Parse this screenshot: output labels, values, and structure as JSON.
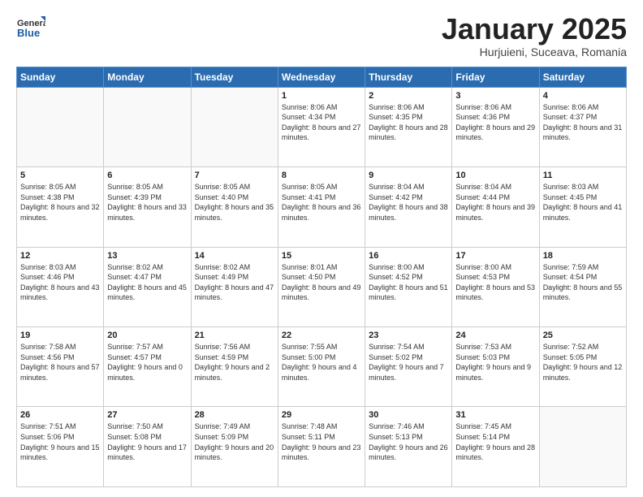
{
  "header": {
    "logo_line1": "General",
    "logo_line2": "Blue",
    "month": "January 2025",
    "location": "Hurjuieni, Suceava, Romania"
  },
  "weekdays": [
    "Sunday",
    "Monday",
    "Tuesday",
    "Wednesday",
    "Thursday",
    "Friday",
    "Saturday"
  ],
  "weeks": [
    [
      {
        "day": "",
        "info": ""
      },
      {
        "day": "",
        "info": ""
      },
      {
        "day": "",
        "info": ""
      },
      {
        "day": "1",
        "info": "Sunrise: 8:06 AM\nSunset: 4:34 PM\nDaylight: 8 hours and 27 minutes."
      },
      {
        "day": "2",
        "info": "Sunrise: 8:06 AM\nSunset: 4:35 PM\nDaylight: 8 hours and 28 minutes."
      },
      {
        "day": "3",
        "info": "Sunrise: 8:06 AM\nSunset: 4:36 PM\nDaylight: 8 hours and 29 minutes."
      },
      {
        "day": "4",
        "info": "Sunrise: 8:06 AM\nSunset: 4:37 PM\nDaylight: 8 hours and 31 minutes."
      }
    ],
    [
      {
        "day": "5",
        "info": "Sunrise: 8:05 AM\nSunset: 4:38 PM\nDaylight: 8 hours and 32 minutes."
      },
      {
        "day": "6",
        "info": "Sunrise: 8:05 AM\nSunset: 4:39 PM\nDaylight: 8 hours and 33 minutes."
      },
      {
        "day": "7",
        "info": "Sunrise: 8:05 AM\nSunset: 4:40 PM\nDaylight: 8 hours and 35 minutes."
      },
      {
        "day": "8",
        "info": "Sunrise: 8:05 AM\nSunset: 4:41 PM\nDaylight: 8 hours and 36 minutes."
      },
      {
        "day": "9",
        "info": "Sunrise: 8:04 AM\nSunset: 4:42 PM\nDaylight: 8 hours and 38 minutes."
      },
      {
        "day": "10",
        "info": "Sunrise: 8:04 AM\nSunset: 4:44 PM\nDaylight: 8 hours and 39 minutes."
      },
      {
        "day": "11",
        "info": "Sunrise: 8:03 AM\nSunset: 4:45 PM\nDaylight: 8 hours and 41 minutes."
      }
    ],
    [
      {
        "day": "12",
        "info": "Sunrise: 8:03 AM\nSunset: 4:46 PM\nDaylight: 8 hours and 43 minutes."
      },
      {
        "day": "13",
        "info": "Sunrise: 8:02 AM\nSunset: 4:47 PM\nDaylight: 8 hours and 45 minutes."
      },
      {
        "day": "14",
        "info": "Sunrise: 8:02 AM\nSunset: 4:49 PM\nDaylight: 8 hours and 47 minutes."
      },
      {
        "day": "15",
        "info": "Sunrise: 8:01 AM\nSunset: 4:50 PM\nDaylight: 8 hours and 49 minutes."
      },
      {
        "day": "16",
        "info": "Sunrise: 8:00 AM\nSunset: 4:52 PM\nDaylight: 8 hours and 51 minutes."
      },
      {
        "day": "17",
        "info": "Sunrise: 8:00 AM\nSunset: 4:53 PM\nDaylight: 8 hours and 53 minutes."
      },
      {
        "day": "18",
        "info": "Sunrise: 7:59 AM\nSunset: 4:54 PM\nDaylight: 8 hours and 55 minutes."
      }
    ],
    [
      {
        "day": "19",
        "info": "Sunrise: 7:58 AM\nSunset: 4:56 PM\nDaylight: 8 hours and 57 minutes."
      },
      {
        "day": "20",
        "info": "Sunrise: 7:57 AM\nSunset: 4:57 PM\nDaylight: 9 hours and 0 minutes."
      },
      {
        "day": "21",
        "info": "Sunrise: 7:56 AM\nSunset: 4:59 PM\nDaylight: 9 hours and 2 minutes."
      },
      {
        "day": "22",
        "info": "Sunrise: 7:55 AM\nSunset: 5:00 PM\nDaylight: 9 hours and 4 minutes."
      },
      {
        "day": "23",
        "info": "Sunrise: 7:54 AM\nSunset: 5:02 PM\nDaylight: 9 hours and 7 minutes."
      },
      {
        "day": "24",
        "info": "Sunrise: 7:53 AM\nSunset: 5:03 PM\nDaylight: 9 hours and 9 minutes."
      },
      {
        "day": "25",
        "info": "Sunrise: 7:52 AM\nSunset: 5:05 PM\nDaylight: 9 hours and 12 minutes."
      }
    ],
    [
      {
        "day": "26",
        "info": "Sunrise: 7:51 AM\nSunset: 5:06 PM\nDaylight: 9 hours and 15 minutes."
      },
      {
        "day": "27",
        "info": "Sunrise: 7:50 AM\nSunset: 5:08 PM\nDaylight: 9 hours and 17 minutes."
      },
      {
        "day": "28",
        "info": "Sunrise: 7:49 AM\nSunset: 5:09 PM\nDaylight: 9 hours and 20 minutes."
      },
      {
        "day": "29",
        "info": "Sunrise: 7:48 AM\nSunset: 5:11 PM\nDaylight: 9 hours and 23 minutes."
      },
      {
        "day": "30",
        "info": "Sunrise: 7:46 AM\nSunset: 5:13 PM\nDaylight: 9 hours and 26 minutes."
      },
      {
        "day": "31",
        "info": "Sunrise: 7:45 AM\nSunset: 5:14 PM\nDaylight: 9 hours and 28 minutes."
      },
      {
        "day": "",
        "info": ""
      }
    ]
  ]
}
